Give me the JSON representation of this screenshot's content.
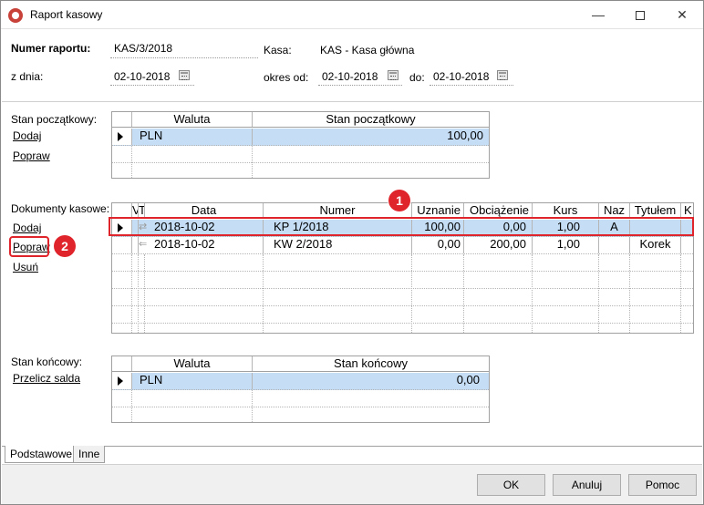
{
  "window": {
    "title": "Raport kasowy"
  },
  "header": {
    "numer_label": "Numer raportu:",
    "numer_value": "KAS/3/2018",
    "kasa_label": "Kasa:",
    "kasa_value": "KAS - Kasa główna",
    "zdnia_label": "z dnia:",
    "zdnia_value": "02-10-2018",
    "okres_od_label": "okres od:",
    "okres_od_value": "02-10-2018",
    "do_label": "do:",
    "do_value": "02-10-2018"
  },
  "stan_poczatkowy": {
    "label": "Stan początkowy:",
    "links": [
      "Dodaj",
      "Popraw"
    ],
    "columns": [
      "Waluta",
      "Stan początkowy"
    ],
    "rows": [
      {
        "waluta": "PLN",
        "stan": "100,00"
      }
    ]
  },
  "dokumenty": {
    "label": "Dokumenty kasowe:",
    "links": [
      "Dodaj",
      "Popraw",
      "Usuń"
    ],
    "columns": [
      "V",
      "T",
      "Data",
      "Numer",
      "Uznanie",
      "Obciążenie",
      "Kurs",
      "Naz",
      "Tytułem",
      "K"
    ],
    "rows": [
      {
        "icon": "transfer-icon",
        "data": "2018-10-02",
        "numer": "KP 1/2018",
        "uznanie": "100,00",
        "obciazenie": "0,00",
        "kurs": "1,00",
        "naz": "A",
        "tytulem": ""
      },
      {
        "icon": "arrow-left-icon",
        "data": "2018-10-02",
        "numer": "KW 2/2018",
        "uznanie": "0,00",
        "obciazenie": "200,00",
        "kurs": "1,00",
        "naz": "",
        "tytulem": "Korek"
      }
    ]
  },
  "stan_koncowy": {
    "label": "Stan końcowy:",
    "links": [
      "Przelicz salda"
    ],
    "columns": [
      "Waluta",
      "Stan końcowy"
    ],
    "rows": [
      {
        "waluta": "PLN",
        "stan": "0,00"
      }
    ]
  },
  "annotations": {
    "badge1": "1",
    "badge2": "2",
    "color": "#e0242b"
  },
  "tabs": [
    "Podstawowe",
    "Inne"
  ],
  "buttons": {
    "ok": "OK",
    "cancel": "Anuluj",
    "help": "Pomoc"
  }
}
